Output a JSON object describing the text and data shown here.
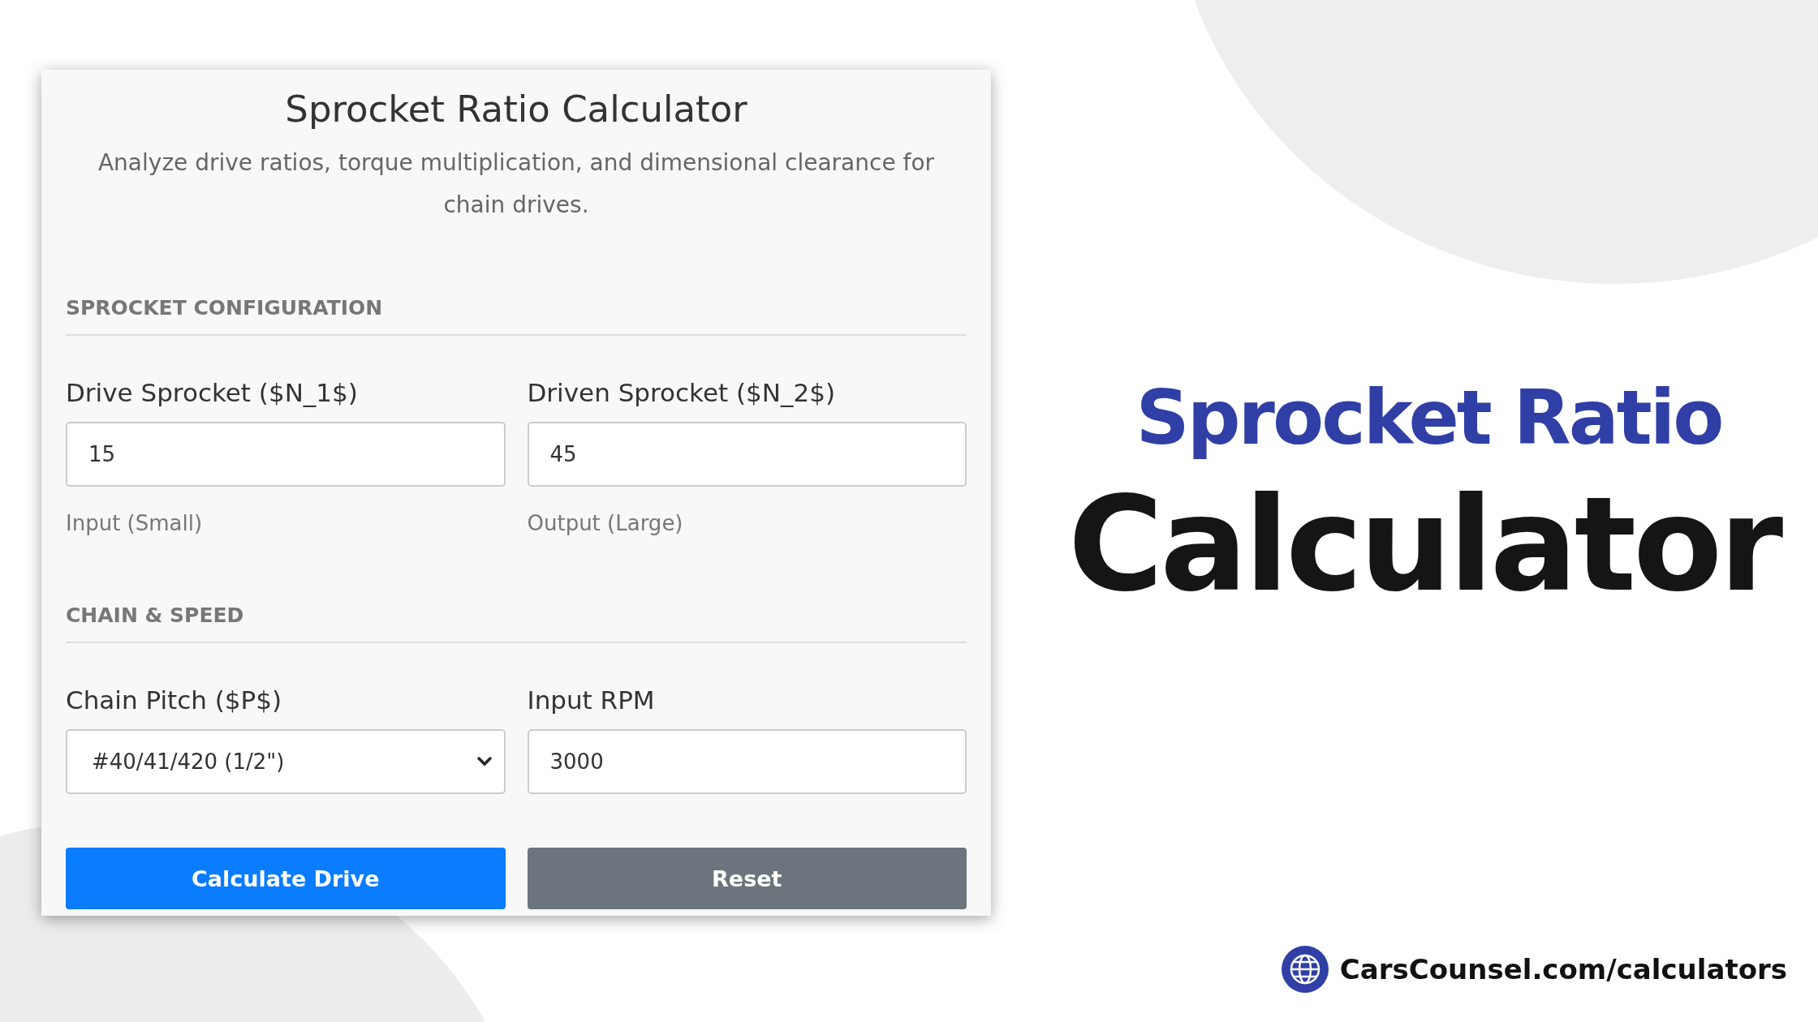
{
  "calculator": {
    "title": "Sprocket Ratio Calculator",
    "subtitle": "Analyze drive ratios, torque multiplication, and dimensional clearance for chain drives.",
    "sections": [
      {
        "heading": "SPROCKET CONFIGURATION",
        "fields": [
          {
            "kind": "input",
            "label": "Drive Sprocket ($N_1$)",
            "value": "15",
            "hint": "Input (Small)"
          },
          {
            "kind": "input",
            "label": "Driven Sprocket ($N_2$)",
            "value": "45",
            "hint": "Output (Large)"
          }
        ]
      },
      {
        "heading": "CHAIN & SPEED",
        "fields": [
          {
            "kind": "select",
            "label": "Chain Pitch ($P$)",
            "value": "#40/41/420 (1/2\")"
          },
          {
            "kind": "input",
            "label": "Input RPM",
            "value": "3000"
          }
        ]
      }
    ],
    "buttons": [
      {
        "kind": "primary",
        "label": "Calculate Drive"
      },
      {
        "kind": "secondary",
        "label": "Reset"
      }
    ]
  },
  "promo": {
    "title_line_1": "Sprocket Ratio",
    "title_line_2": "Calculator",
    "website": "CarsCounsel.com/calculators"
  }
}
